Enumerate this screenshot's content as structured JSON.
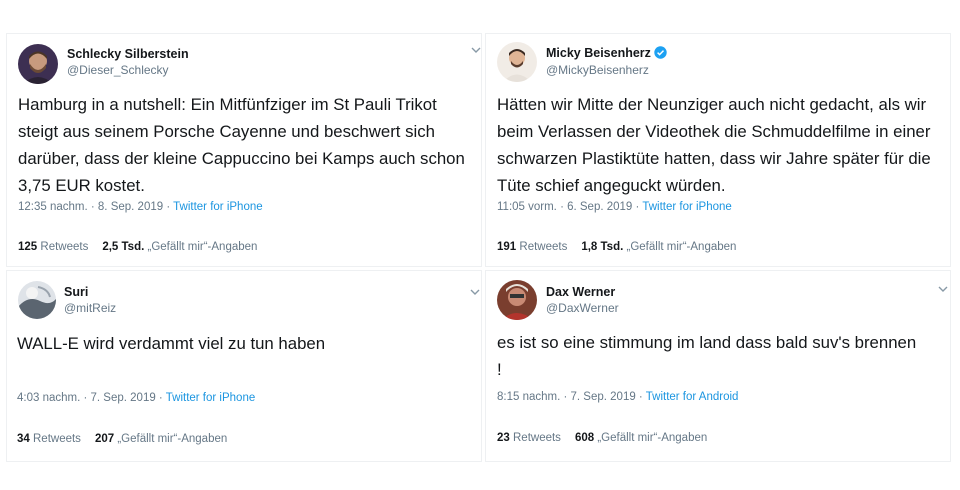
{
  "tweets": [
    {
      "name": "Schlecky Silberstein",
      "handle": "@Dieser_Schlecky",
      "verified": false,
      "text": "Hamburg in a nutshell: Ein Mitfünfziger  im St Pauli Trikot steigt aus seinem Porsche Cayenne und beschwert sich darüber, dass der kleine Cappuccino bei Kamps auch schon 3,75 EUR kostet.",
      "time": "12:35 nachm. · 8. Sep. 2019 · ",
      "source": "Twitter for iPhone",
      "retweets": "125",
      "retweets_label": "Retweets",
      "likes": "2,5 Tsd.",
      "likes_label": "„Gefällt mir“-Angaben",
      "avatar_color": "#3b2a4a"
    },
    {
      "name": "Micky Beisenherz",
      "handle": "@MickyBeisenherz",
      "verified": true,
      "text": "Hätten wir Mitte der Neunziger auch nicht gedacht, als wir beim Verlassen der Videothek die Schmuddelfilme in einer schwarzen Plastiktüte hatten, dass wir Jahre später für die Tüte schief angeguckt würden.",
      "time": "11:05 vorm. · 6. Sep. 2019 · ",
      "source": "Twitter for iPhone",
      "retweets": "191",
      "retweets_label": "Retweets",
      "likes": "1,8 Tsd.",
      "likes_label": "„Gefällt mir“-Angaben",
      "avatar_color": "#f1ece6"
    },
    {
      "name": "Suri",
      "handle": "@mitReiz",
      "verified": false,
      "text": "WALL-E wird verdammt viel zu tun haben",
      "time": "4:03 nachm. · 7. Sep. 2019 · ",
      "source": "Twitter for iPhone",
      "retweets": "34",
      "retweets_label": "Retweets",
      "likes": "207",
      "likes_label": "„Gefällt mir“-Angaben",
      "avatar_color": "#c7ccd3"
    },
    {
      "name": "Dax Werner",
      "handle": "@DaxWerner",
      "verified": false,
      "text": "es ist so eine stimmung im land dass bald suv's brennen !",
      "time": "8:15 nachm. · 7. Sep. 2019 · ",
      "source": "Twitter for Android",
      "retweets": "23",
      "retweets_label": "Retweets",
      "likes": "608",
      "likes_label": "„Gefällt mir“-Angaben",
      "avatar_color": "#8a4a3a"
    }
  ],
  "icons": {
    "caret": "chevron-down-icon",
    "verified": "verified-badge-icon"
  },
  "colors": {
    "link": "#1b95e0",
    "muted": "#657786",
    "verified": "#1da1f2"
  }
}
